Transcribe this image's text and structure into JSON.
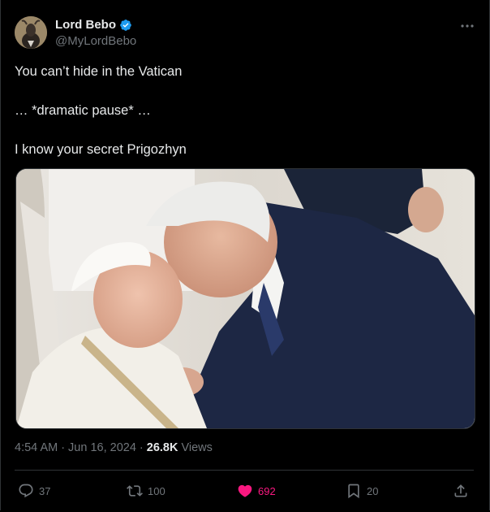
{
  "author": {
    "display_name": "Lord Bebo",
    "handle": "@MyLordBebo",
    "verified": true,
    "avatar_icon": "goat-avatar"
  },
  "tweet": {
    "lines": [
      "You can’t hide in the Vatican",
      "… *dramatic pause* …",
      "I know your secret Prigozhyn"
    ]
  },
  "media": {
    "icon": "photo-image"
  },
  "meta": {
    "time": "4:54 AM",
    "separator1": "·",
    "date": "Jun 16, 2024",
    "separator2": "·",
    "views_count": "26.8K",
    "views_label": "Views"
  },
  "actions": {
    "replies": "37",
    "reposts": "100",
    "likes": "692",
    "bookmarks": "20"
  },
  "colors": {
    "background": "#000000",
    "text": "#e7e9ea",
    "muted": "#71767b",
    "like": "#f91880",
    "verified": "#1d9bf0",
    "divider": "#2f3336"
  }
}
